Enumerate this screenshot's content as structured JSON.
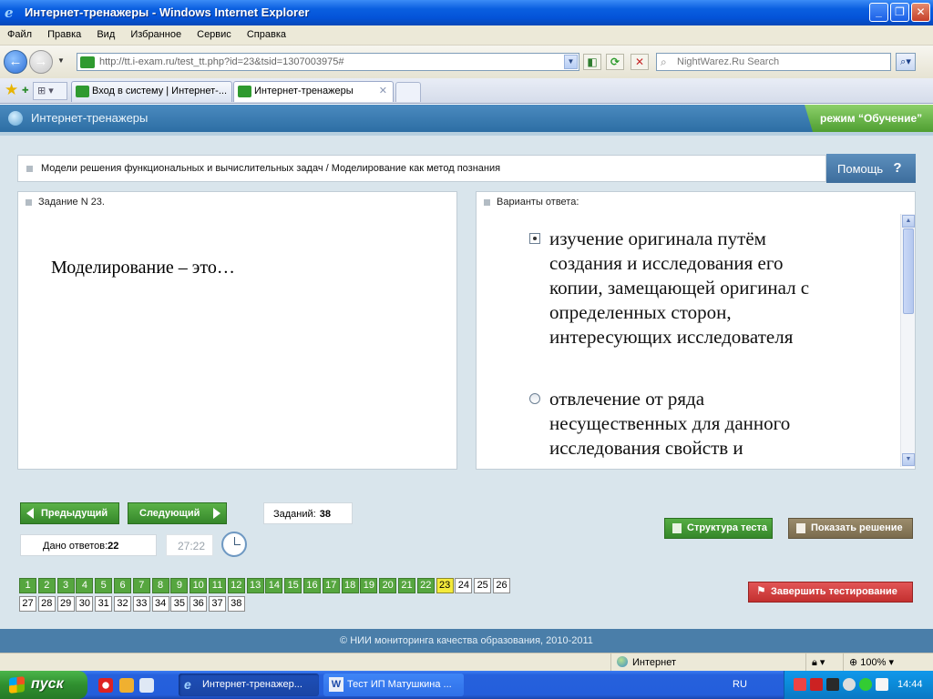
{
  "window": {
    "title": "Интернет-тренажеры - Windows Internet Explorer",
    "minimize": "_",
    "maximize": "❐",
    "close": "✕"
  },
  "menu": [
    "Файл",
    "Правка",
    "Вид",
    "Избранное",
    "Сервис",
    "Справка"
  ],
  "address": {
    "url": "http://tt.i-exam.ru/test_tt.php?id=23&tsid=1307003975#",
    "search_placeholder": "NightWarez.Ru Search"
  },
  "tabs": [
    {
      "label": "Вход в систему | Интернет-..."
    },
    {
      "label": "Интернет-тренажеры"
    }
  ],
  "app": {
    "title": "Интернет-тренажеры",
    "mode": "режим “Обучение”",
    "topic": "Модели решения функциональных и вычислительных задач / Моделирование как метод познания",
    "help_label": "Помощь",
    "help_icon": "?"
  },
  "task": {
    "header": "Задание N 23.",
    "question": "Моделирование – это…"
  },
  "answers": {
    "header": "Варианты ответа:",
    "options": [
      {
        "text": "изучение оригинала путём создания и исследования его копии, замещающей оригинал с определенных сторон, интересующих исследователя",
        "selected": true
      },
      {
        "text": "отвлечение от ряда несущественных для данного исследования свойств и",
        "selected": false
      }
    ]
  },
  "controls": {
    "prev_label": "Предыдущий",
    "next_label": "Следующий",
    "tasks_label": "Заданий:",
    "tasks_count": "38",
    "answered_label": "Дано ответов:",
    "answered_count": "22",
    "timer": "27:22",
    "structure_label": "Структура теста",
    "solution_label": "Показать решение",
    "finish_label": "Завершить тестирование"
  },
  "questions": {
    "row1": [
      "1",
      "2",
      "3",
      "4",
      "5",
      "6",
      "7",
      "8",
      "9",
      "10",
      "11",
      "12",
      "13",
      "14",
      "15",
      "16",
      "17",
      "18",
      "19",
      "20",
      "21",
      "22",
      "23",
      "24",
      "25",
      "26"
    ],
    "row2": [
      "27",
      "28",
      "29",
      "30",
      "31",
      "32",
      "33",
      "34",
      "35",
      "36",
      "37",
      "38"
    ],
    "answered_upto": 22,
    "current": "23"
  },
  "footer": "© НИИ мониторинга качества образования, 2010-2011",
  "status": {
    "zone": "Интернет",
    "zoom": "100%"
  },
  "taskbar": {
    "start_label": "пуск",
    "tasks": [
      {
        "label": "Интернет-тренажер..."
      },
      {
        "label": "Тест ИП Матушкина ..."
      }
    ],
    "lang": "RU",
    "time": "14:44"
  },
  "colors": {
    "green_done": "#56a63f",
    "current_yellow": "#f4ea3a",
    "header_blue": "#3a7db3",
    "finish_red": "#d9393a"
  }
}
